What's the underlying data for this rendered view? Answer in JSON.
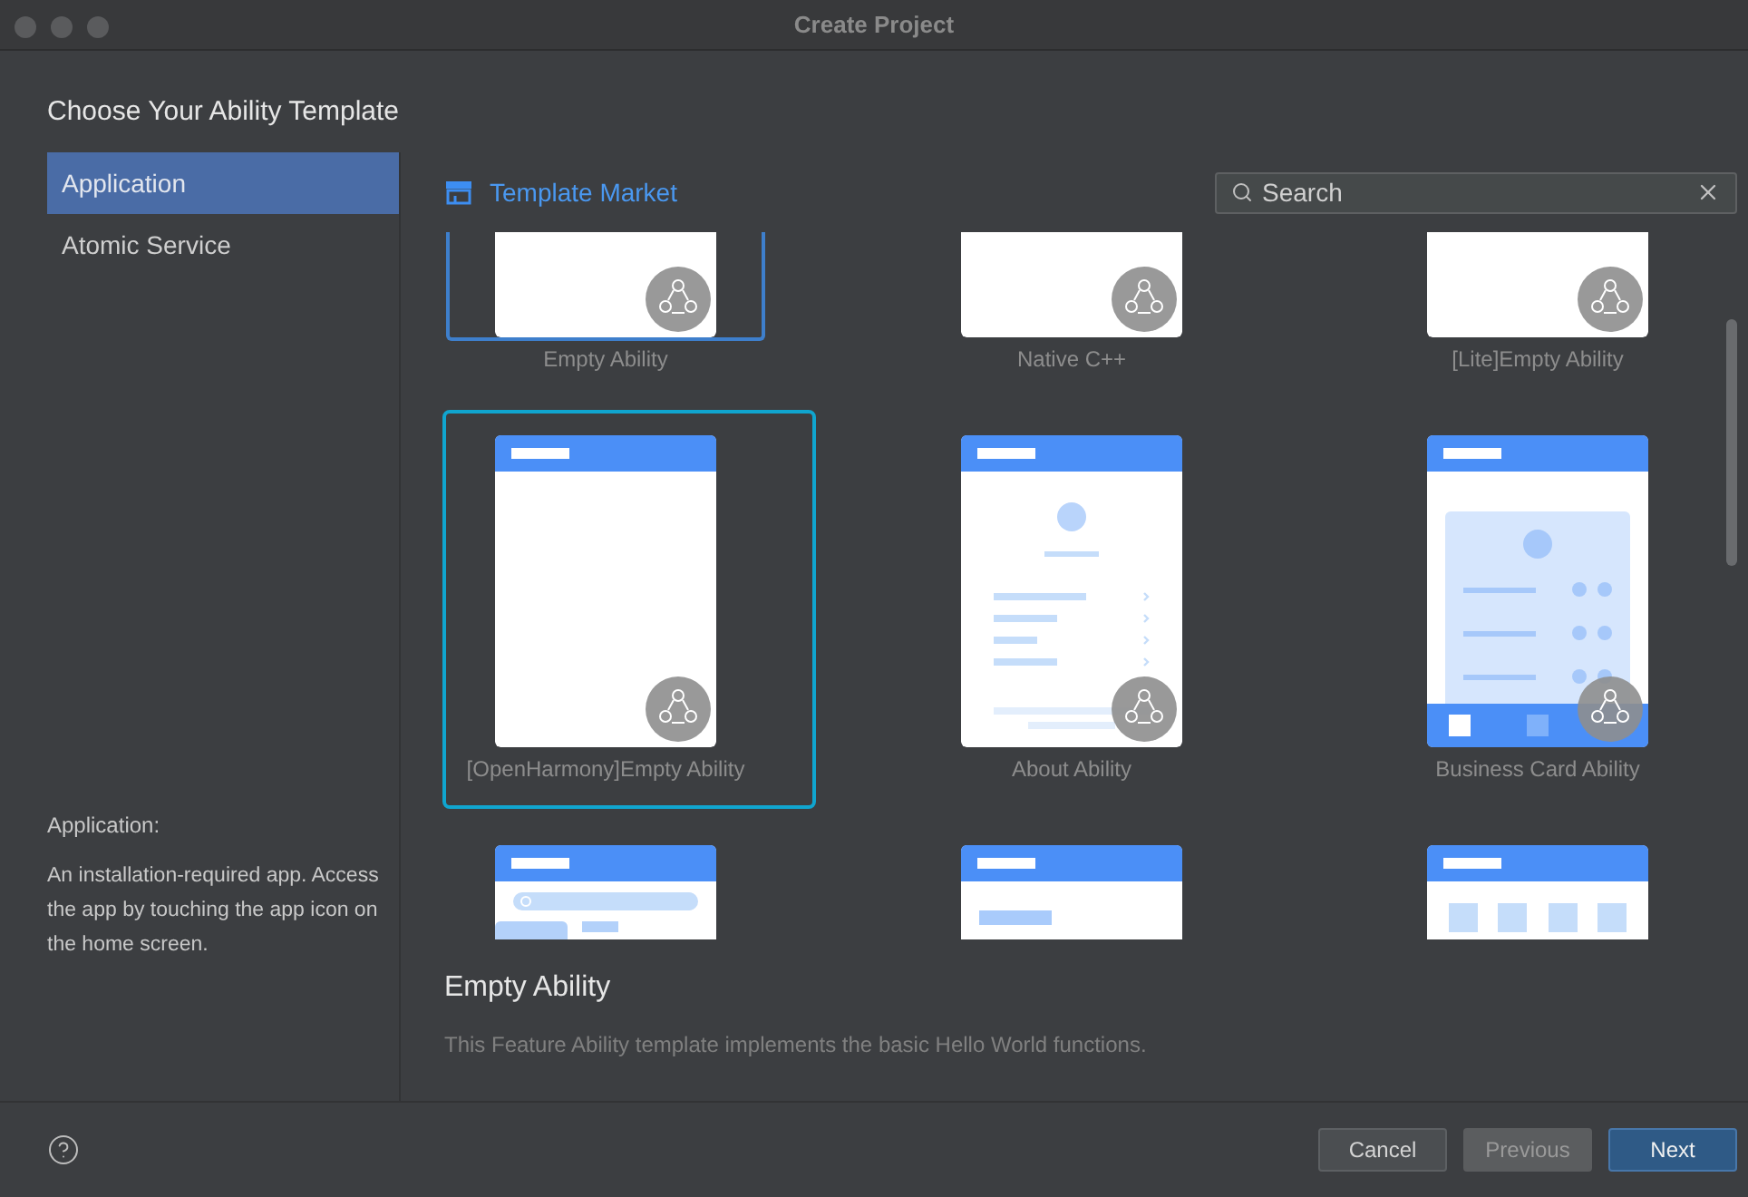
{
  "window": {
    "title": "Create Project"
  },
  "heading": "Choose Your Ability Template",
  "sidebar": {
    "items": [
      {
        "label": "Application",
        "selected": true
      },
      {
        "label": "Atomic Service",
        "selected": false
      }
    ],
    "description_title": "Application:",
    "description": "An installation-required app. Access the app by touching the app icon on the home screen."
  },
  "market": {
    "label": "Template Market"
  },
  "search": {
    "placeholder": "Search"
  },
  "templates": [
    {
      "name": "Empty Ability",
      "kind": "blank",
      "badge": true,
      "hovered": true,
      "selected": false
    },
    {
      "name": "Native C++",
      "kind": "blank",
      "badge": true,
      "hovered": false,
      "selected": false
    },
    {
      "name": "[Lite]Empty Ability",
      "kind": "blank",
      "badge": true,
      "hovered": false,
      "selected": false
    },
    {
      "name": "[OpenHarmony]Empty Ability",
      "kind": "empty",
      "badge": true,
      "hovered": false,
      "selected": true
    },
    {
      "name": "About Ability",
      "kind": "about",
      "badge": true,
      "hovered": false,
      "selected": false
    },
    {
      "name": "Business Card Ability",
      "kind": "business_card",
      "badge": true,
      "hovered": false,
      "selected": false
    },
    {
      "kind": "list_search",
      "hovered": false,
      "selected": false
    },
    {
      "kind": "form",
      "hovered": false,
      "selected": false
    },
    {
      "kind": "grid",
      "hovered": false,
      "selected": false
    }
  ],
  "details": {
    "title": "Empty Ability",
    "description": "This Feature Ability template implements the basic Hello World functions."
  },
  "buttons": [
    {
      "label": "Cancel",
      "kind": "default"
    },
    {
      "label": "Previous",
      "kind": "disabled"
    },
    {
      "label": "Next",
      "kind": "primary"
    }
  ]
}
